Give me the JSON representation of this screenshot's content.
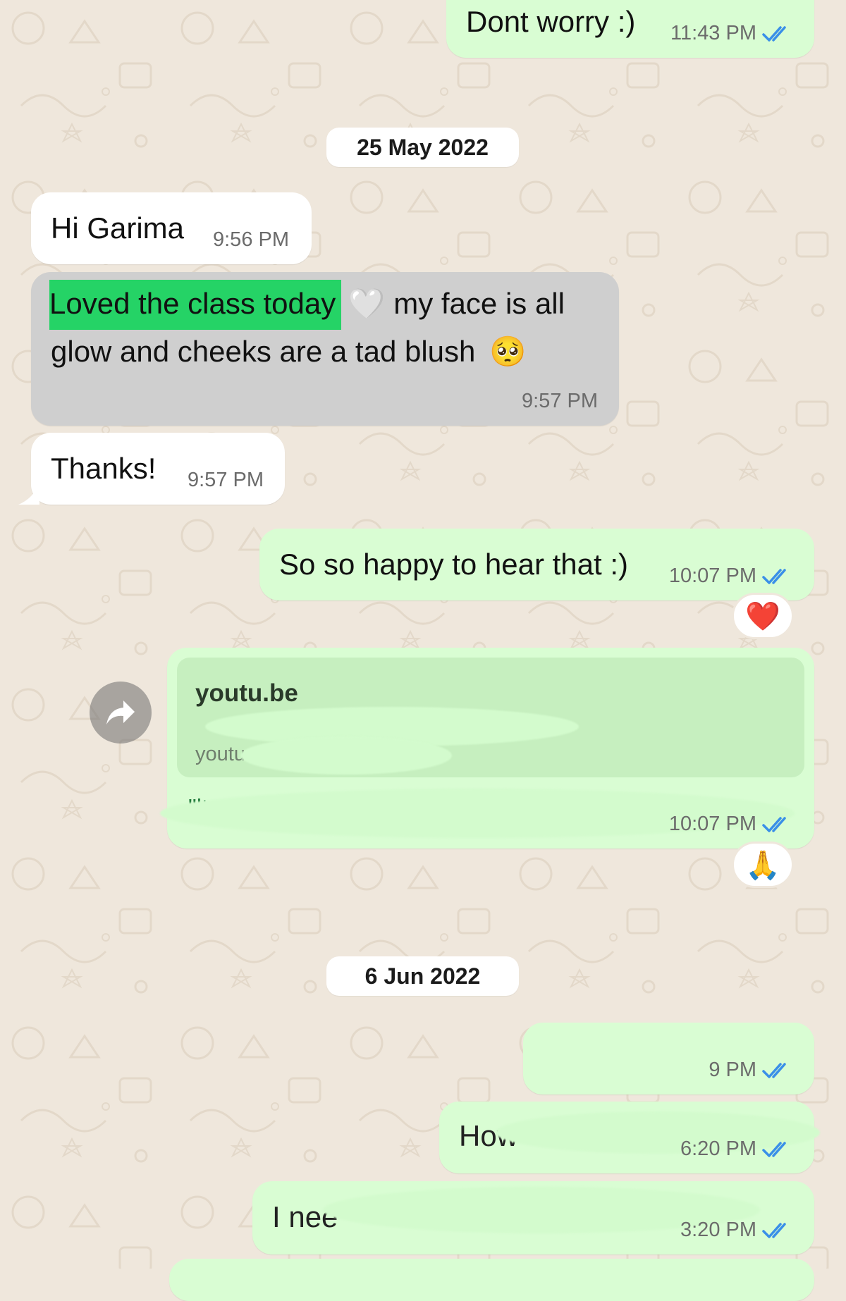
{
  "chat": {
    "messages": [
      {
        "text": "Dont worry :)",
        "time": "11:43 PM"
      },
      {
        "date": "25 May 2022"
      },
      {
        "text": "Hi Garima",
        "time": "9:56 PM"
      },
      {
        "highlight": "Loved the class today",
        "text_rest": " my face is all",
        "text_line2": "glow and cheeks are a tad blush",
        "emoji_heart": "🤍",
        "emoji_face": "🥺",
        "time": "9:57 PM"
      },
      {
        "text": "Thanks!",
        "time": "9:57 PM"
      },
      {
        "text": "So so happy to hear that :)",
        "time": "10:07 PM",
        "reaction": "❤️"
      },
      {
        "link_domain": "youtu.be",
        "link_sub": "youtu",
        "link_line": "\"lt",
        "time": "10:07 PM",
        "reaction": "🙏"
      },
      {
        "date": "6 Jun 2022"
      },
      {
        "time": "9 PM"
      },
      {
        "text": "How",
        "time": "6:20 PM"
      },
      {
        "text": "I nee",
        "time": "3:20 PM"
      }
    ]
  },
  "colors": {
    "outgoing_bubble": "#d9fdd3",
    "incoming_bubble": "#ffffff",
    "selected_bubble": "#cfcfcf",
    "highlight": "#25d366",
    "read_ticks": "#3a8fe8",
    "background": "#efe7dc"
  },
  "icons": {
    "read_receipt": "double-check-icon",
    "forward": "forward-arrow-icon"
  }
}
